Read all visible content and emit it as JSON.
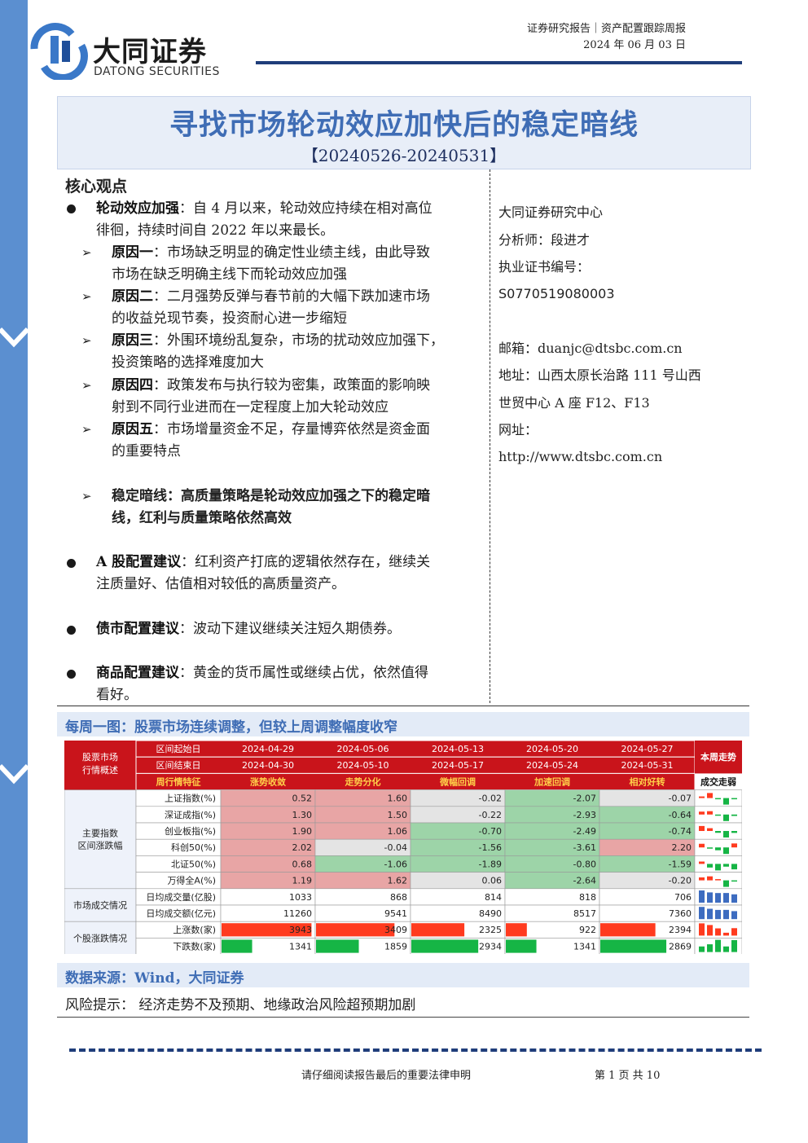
{
  "header": {
    "brand_cn": "大同证券",
    "brand_en": "DATONG SECURITIES",
    "report_type": "证券研究报告｜资产配置跟踪周报",
    "date": "2024 年 06 月 03 日"
  },
  "title": "寻找市场轮动效应加快后的稳定暗线",
  "subtitle": "【20240526-20240531】",
  "core": {
    "heading": "核心观点",
    "b1_bold": "轮动效应加强",
    "b1_text": "：自 4 月以来，轮动效应持续在相对高位",
    "b1_text2": "徘徊，持续时间自 2022 年以来最长。",
    "r1_bold": "原因一",
    "r1_text": "：市场缺乏明显的确定性业绩主线，由此导致",
    "r1_text2": "市场在缺乏明确主线下而轮动效应加强",
    "r2_bold": "原因二",
    "r2_text": "：二月强势反弹与春节前的大幅下跌加速市场",
    "r2_text2": "的收益兑现节奏，投资耐心进一步缩短",
    "r3_bold": "原因三",
    "r3_text": "：外围环境纷乱复杂，市场的扰动效应加强下，",
    "r3_text2": "投资策略的选择难度加大",
    "r4_bold": "原因四",
    "r4_text": "：政策发布与执行较为密集，政策面的影响映",
    "r4_text2": "射到不同行业进而在一定程度上加大轮动效应",
    "r5_bold": "原因五",
    "r5_text": "：市场增量资金不足，存量博弈依然是资金面",
    "r5_text2": "的重要特点",
    "r6_text": "稳定暗线：高质量策略是轮动效应加强之下的稳定暗",
    "r6_text2": "线，红利与质量策略依然高效",
    "b2_bold": "A 股配置建议",
    "b2_text": "：红利资产打底的逻辑依然存在，继续关",
    "b2_text2": "注质量好、估值相对较低的高质量资产。",
    "b3_bold": "债市配置建议",
    "b3_text": "：波动下建议继续关注短久期债券。",
    "b4_bold": "商品配置建议",
    "b4_text": "：黄金的货币属性或继续占优，依然值得",
    "b4_text2": "看好。"
  },
  "side": {
    "center": "大同证券研究中心",
    "analyst": "分析师：段进才",
    "cert_label": "执业证书编号：",
    "cert_no": "S0770519080003",
    "email": "邮箱：duanjc@dtsbc.com.cn",
    "address1": "地址：山西太原长治路 111 号山西",
    "address2": "世贸中心 A 座 F12、F13",
    "web_label": "网址：",
    "web": "http://www.dtsbc.com.cn"
  },
  "figure_title": "每周一图：股票市场连续调整，但较上周调整幅度收窄",
  "table": {
    "corner": [
      "股票市场",
      "行情概述"
    ],
    "hdr_labels": [
      "区间起始日",
      "区间结束日",
      "周行情特征"
    ],
    "starts": [
      "2024-04-29",
      "2024-05-06",
      "2024-05-13",
      "2024-05-20",
      "2024-05-27"
    ],
    "ends": [
      "2024-04-30",
      "2024-05-10",
      "2024-05-17",
      "2024-05-24",
      "2024-05-31"
    ],
    "features": [
      "涨势收敛",
      "走势分化",
      "微幅回调",
      "加速回调",
      "相对好转"
    ],
    "trend_hdr1": "本周走势",
    "trend_hdr2": "成交走弱",
    "groups": [
      {
        "label": [
          "主要指数",
          "区间涨跌幅"
        ],
        "rows": [
          {
            "name": "上证指数(%)",
            "v": [
              "0.52",
              "1.60",
              "-0.02",
              "-2.07",
              "-0.07"
            ]
          },
          {
            "name": "深证成指(%)",
            "v": [
              "1.30",
              "1.50",
              "-0.22",
              "-2.93",
              "-0.64"
            ]
          },
          {
            "name": "创业板指(%)",
            "v": [
              "1.90",
              "1.06",
              "-0.70",
              "-2.49",
              "-0.74"
            ]
          },
          {
            "name": "科创50(%)",
            "v": [
              "2.02",
              "-0.04",
              "-1.56",
              "-3.61",
              "2.20"
            ]
          },
          {
            "name": "北证50(%)",
            "v": [
              "0.68",
              "-1.06",
              "-1.89",
              "-0.80",
              "-1.59"
            ]
          },
          {
            "name": "万得全A(%)",
            "v": [
              "1.19",
              "1.62",
              "0.06",
              "-2.64",
              "-0.20"
            ]
          }
        ]
      },
      {
        "label": [
          "市场成交情况"
        ],
        "rows": [
          {
            "name": "日均成交量(亿股)",
            "v": [
              "1033",
              "868",
              "814",
              "818",
              "706"
            ]
          },
          {
            "name": "日均成交额(亿元)",
            "v": [
              "11260",
              "9541",
              "8490",
              "8517",
              "7360"
            ]
          }
        ]
      },
      {
        "label": [
          "个股涨跌情况"
        ],
        "rows": [
          {
            "name": "上涨数(家)",
            "v": [
              "3943",
              "3409",
              "2325",
              "922",
              "2394"
            ]
          },
          {
            "name": "下跌数(家)",
            "v": [
              "1341",
              "1859",
              "2934",
              "1341",
              "2869"
            ]
          }
        ]
      }
    ],
    "colors": {
      "up": "#e8a5a5",
      "down": "#9dd4a8",
      "neutral": "#e4e4e4",
      "red_bar": "#ff3b1f",
      "green_bar": "#16b545",
      "blue_bar": "#3d6cc0",
      "hdr": "#c9141b"
    }
  },
  "source": "数据来源：Wind，大同证券",
  "risk": "风险提示：  经济走势不及预期、地缘政治风险超预期加剧",
  "footer": {
    "statement": "请仔细阅读报告最后的重要法律申明",
    "page": "第 1 页 共 10"
  }
}
